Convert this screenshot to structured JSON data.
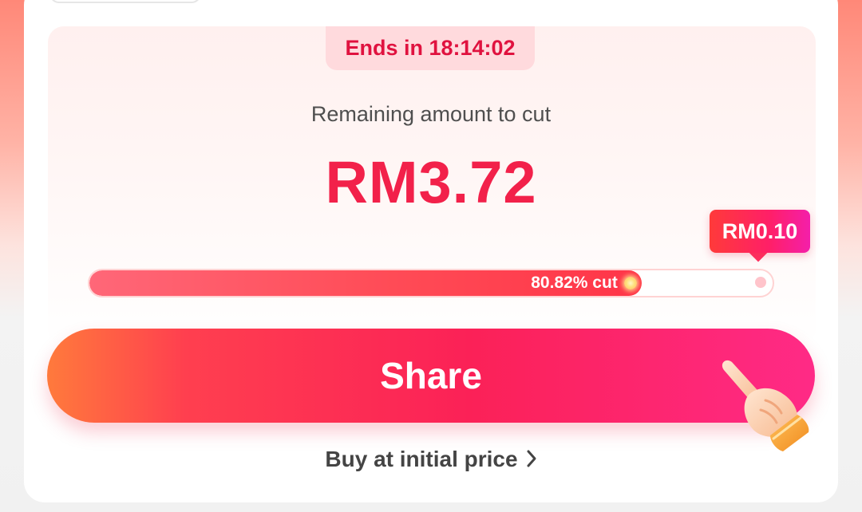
{
  "timer": {
    "text": "Ends in 18:14:02"
  },
  "summary": {
    "label": "Remaining amount to cut",
    "amount": "RM3.72"
  },
  "progress": {
    "percent": 80.82,
    "label": "80.82% cut",
    "tooltip": "RM0.10"
  },
  "actions": {
    "share_label": "Share",
    "buy_label": "Buy at initial price"
  },
  "icons": {
    "chevron": "chevron-right-icon",
    "hand": "pointing-hand-icon"
  },
  "colors": {
    "accent": "#f2214a",
    "timer_bg": "#ffdadd"
  }
}
